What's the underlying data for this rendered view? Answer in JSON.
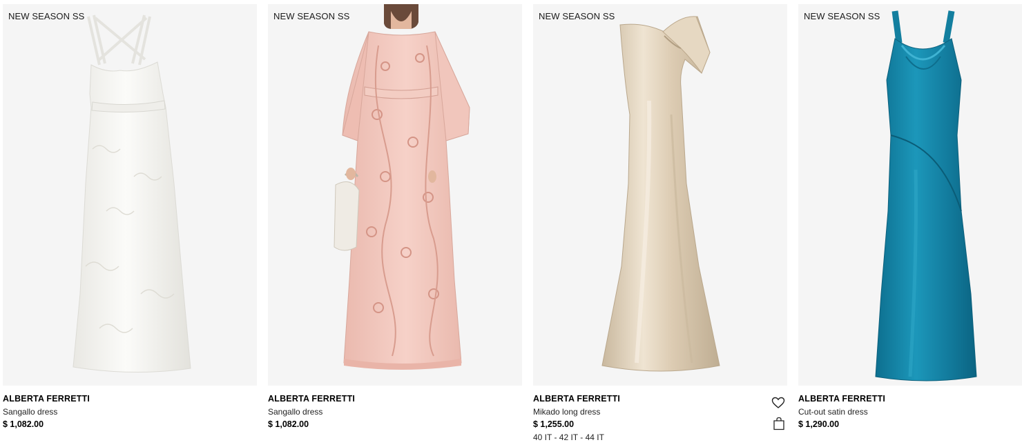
{
  "products": [
    {
      "badge": "NEW SEASON SS",
      "brand": "ALBERTA FERRETTI",
      "name": "Sangallo dress",
      "price": "$ 1,082.00",
      "color": "#f4f3ef"
    },
    {
      "badge": "NEW SEASON SS",
      "brand": "ALBERTA FERRETTI",
      "name": "Sangallo dress",
      "price": "$ 1,082.00",
      "color": "#f3c8c0"
    },
    {
      "badge": "NEW SEASON SS",
      "brand": "ALBERTA FERRETTI",
      "name": "Mikado long dress",
      "price": "$ 1,255.00",
      "sizes": "40 IT - 42 IT - 44 IT",
      "color": "#d8c8b0",
      "icons": [
        "heart-icon",
        "shopping-bag-icon"
      ]
    },
    {
      "badge": "NEW SEASON SS",
      "brand": "ALBERTA FERRETTI",
      "name": "Cut-out satin dress",
      "price": "$ 1,290.00",
      "color": "#1a8cae"
    }
  ]
}
